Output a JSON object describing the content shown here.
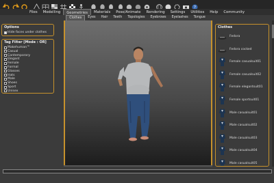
{
  "menu": {
    "tabs": [
      "Files",
      "Modelling",
      "Geometries",
      "Materials",
      "Pose/Animate",
      "Rendering",
      "Settings",
      "Utilities",
      "Help",
      "Community"
    ],
    "active": "Geometries"
  },
  "submenu": {
    "tabs": [
      "Clothes",
      "Eyes",
      "Hair",
      "Teeth",
      "Topologies",
      "Eyebrows",
      "Eyelashes",
      "Tongue"
    ],
    "active": "Clothes"
  },
  "options": {
    "title": "Options",
    "hide_faces_label": "Hide faces under clothes",
    "hide_faces_checked": true
  },
  "tag_filter": {
    "title": "Tag Filter [Mode : OR]",
    "tags": [
      "Makehuman™",
      "Casual",
      "Contemporary",
      "Elegant",
      "Female",
      "Formal",
      "Glasses",
      "Hats",
      "Male",
      "Shoes",
      "Sport",
      "Unisex"
    ]
  },
  "clothes": {
    "title": "Clothes",
    "items": [
      {
        "label": "Fedora",
        "icon": "hat-icon"
      },
      {
        "label": "Fedora cocked",
        "icon": "hat-icon"
      },
      {
        "label": "Female casualsuit01",
        "icon": "suit-icon"
      },
      {
        "label": "Female casualsuit02",
        "icon": "suit-icon"
      },
      {
        "label": "Female elegantsuit01",
        "icon": "suit-icon"
      },
      {
        "label": "Female sportsuit01",
        "icon": "suit-icon"
      },
      {
        "label": "Male casualsuit01",
        "icon": "suit-icon"
      },
      {
        "label": "Male casualsuit02",
        "icon": "suit-icon"
      },
      {
        "label": "Male casualsuit03",
        "icon": "suit-icon"
      },
      {
        "label": "Male casualsuit04",
        "icon": "suit-icon"
      },
      {
        "label": "Male casualsuit05",
        "icon": "suit-icon"
      }
    ]
  },
  "colors": {
    "accent": "#c7922c",
    "panel": "#3b3b3b",
    "viewport_top": "#6e6e6e",
    "viewport_bottom": "#1c1c1c"
  }
}
